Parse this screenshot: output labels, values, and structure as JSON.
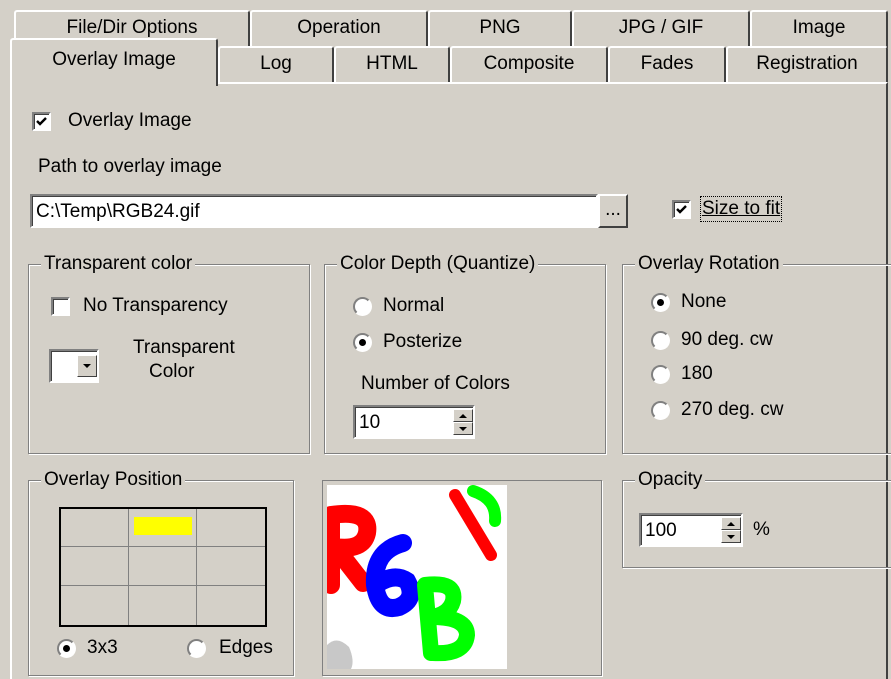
{
  "tabs_row1": [
    "File/Dir Options",
    "Operation",
    "PNG",
    "JPG / GIF",
    "Image"
  ],
  "tabs_row2": [
    "Overlay Image",
    "Log",
    "HTML",
    "Composite",
    "Fades",
    "Registration"
  ],
  "active_tab": "Overlay Image",
  "overlay_checkbox": {
    "label": "Overlay Image",
    "checked": true
  },
  "path": {
    "label": "Path to overlay image",
    "value": "C:\\Temp\\RGB24.gif",
    "browse_label": "..."
  },
  "size_to_fit": {
    "label": "Size to fit",
    "checked": true
  },
  "transparent": {
    "title": "Transparent color",
    "no_transparency_label": "No Transparency",
    "no_transparency_checked": false,
    "color_label_line1": "Transparent",
    "color_label_line2": "Color",
    "swatch_color": "#ffffff"
  },
  "color_depth": {
    "title": "Color Depth (Quantize)",
    "options": [
      "Normal",
      "Posterize"
    ],
    "selected": "Posterize",
    "num_colors_label": "Number of Colors",
    "num_colors_value": "10"
  },
  "rotation": {
    "title": "Overlay Rotation",
    "options": [
      "None",
      "90 deg. cw",
      "180",
      "270 deg. cw"
    ],
    "selected": "None"
  },
  "position": {
    "title": "Overlay Position",
    "grid_options": [
      "3x3",
      "Edges"
    ],
    "selected": "3x3",
    "highlight_color": "#ffff00"
  },
  "opacity": {
    "title": "Opacity",
    "value": "100",
    "unit": "%"
  },
  "preview": {
    "letters": [
      "R",
      "6",
      "B"
    ],
    "colors": {
      "red": "#ff0000",
      "blue": "#0000ff",
      "green": "#00ff00"
    }
  }
}
